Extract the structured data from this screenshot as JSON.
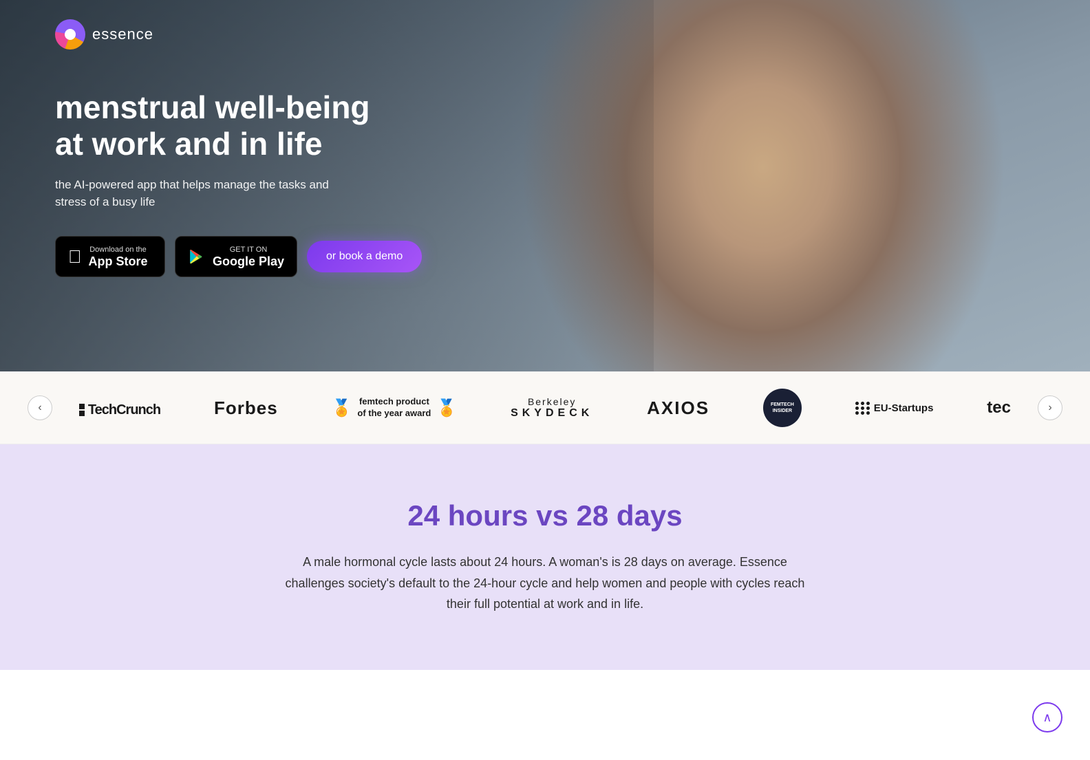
{
  "brand": {
    "name": "essence"
  },
  "hero": {
    "title_line1": "menstrual well-being",
    "title_line2": "at work and in life",
    "subtitle": "the AI-powered app that helps manage the tasks and stress of a busy life",
    "cta_appstore_sub": "Download on the",
    "cta_appstore_main": "App Store",
    "cta_google_sub": "GET IT ON",
    "cta_google_main": "Google Play",
    "cta_demo": "or book a demo"
  },
  "logos": {
    "prev_label": "‹",
    "next_label": "›",
    "items": [
      {
        "id": "techcrunch",
        "text": "TechCrunch"
      },
      {
        "id": "forbes",
        "text": "Forbes"
      },
      {
        "id": "femtech",
        "line1": "femtech product",
        "line2": "of the year award"
      },
      {
        "id": "berkeley",
        "line1": "Berkeley",
        "line2": "SKYDECK"
      },
      {
        "id": "axios",
        "text": "AXIOS"
      },
      {
        "id": "femtech-insider",
        "text": "FEMTECH INSIDER"
      },
      {
        "id": "eu-startups",
        "text": "EU-Startups"
      },
      {
        "id": "tec",
        "text": "tec"
      }
    ]
  },
  "section2": {
    "title": "24 hours vs 28 days",
    "body": "A male hormonal cycle lasts about 24 hours. A woman's is 28 days on average. Essence challenges society's default to the 24-hour cycle and help women and people with cycles reach their full potential at work and in life."
  },
  "scroll_top_label": "∧"
}
